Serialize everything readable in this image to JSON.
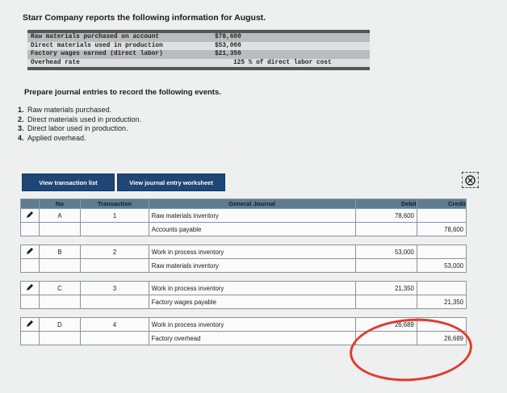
{
  "heading": "Starr Company reports the following information for August.",
  "info_rows": [
    {
      "label": "Raw materials purchased on account",
      "value": "$78,600"
    },
    {
      "label": "Direct materials used in production",
      "value": "$53,000"
    },
    {
      "label": "Factory wages earned (direct labor)",
      "value": "$21,350"
    },
    {
      "label": "Overhead rate",
      "value": "125 % of direct labor cost"
    }
  ],
  "prepare_text": "Prepare journal entries to record the following events.",
  "events": [
    {
      "num": "1.",
      "text": "Raw materials purchased."
    },
    {
      "num": "2.",
      "text": "Direct materials used in production."
    },
    {
      "num": "3.",
      "text": "Direct labor used in production."
    },
    {
      "num": "4.",
      "text": "Applied overhead."
    }
  ],
  "buttons": {
    "transaction_list": "View transaction list",
    "journal_worksheet": "View journal entry worksheet"
  },
  "table": {
    "headers": {
      "no": "No",
      "transaction": "Transaction",
      "journal": "General Journal",
      "debit": "Debit",
      "credit": "Credit"
    },
    "entries": [
      {
        "no": "A",
        "transaction": "1",
        "debit_account": "Raw materials inventory",
        "credit_account": "Accounts payable",
        "debit": "78,600",
        "credit": "78,600"
      },
      {
        "no": "B",
        "transaction": "2",
        "debit_account": "Work in process inventory",
        "credit_account": "Raw materials inventory",
        "debit": "53,000",
        "credit": "53,000"
      },
      {
        "no": "C",
        "transaction": "3",
        "debit_account": "Work in process inventory",
        "credit_account": "Factory wages payable",
        "debit": "21,350",
        "credit": "21,350"
      },
      {
        "no": "D",
        "transaction": "4",
        "debit_account": "Work in process inventory",
        "credit_account": "Factory overhead",
        "debit": "26,689",
        "credit": "26,689"
      }
    ]
  },
  "icons": {
    "edit": "pencil-icon",
    "close": "close-icon"
  },
  "colors": {
    "button": "#1f4675",
    "header": "#5d7c8f",
    "annotation": "#e33a2f"
  }
}
